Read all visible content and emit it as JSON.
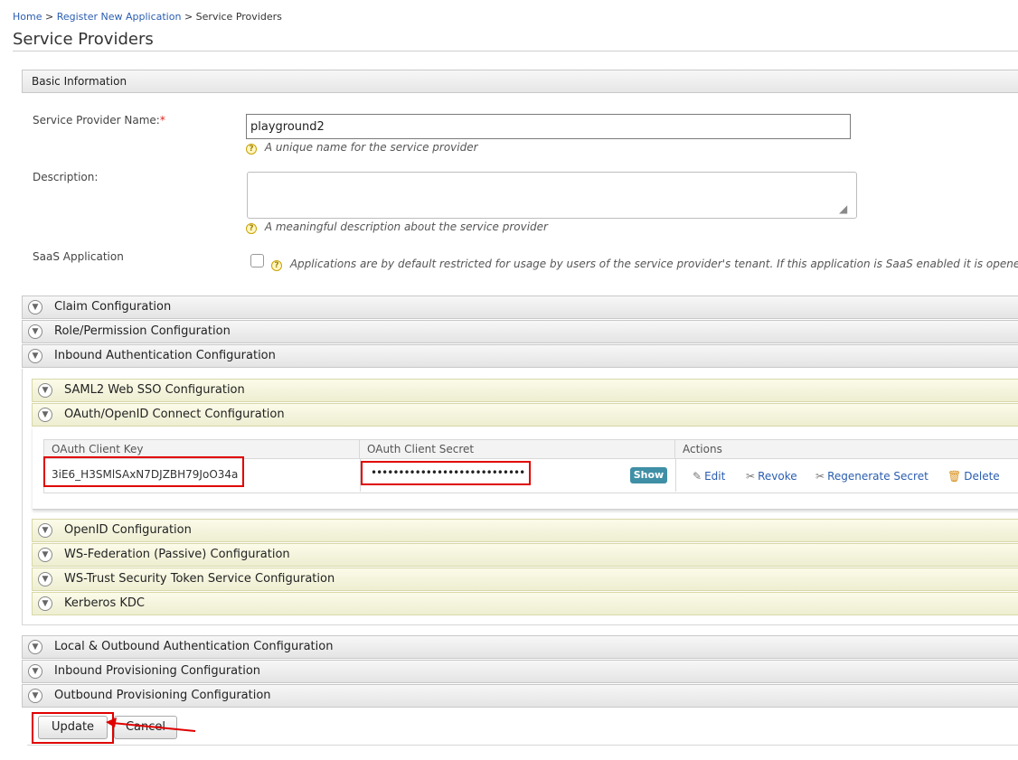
{
  "breadcrumb": {
    "home": "Home",
    "sep1": ">",
    "register": "Register New Application",
    "sep2": ">",
    "current": "Service Providers"
  },
  "page": {
    "title": "Service Providers"
  },
  "basic_info": {
    "header": "Basic Information",
    "name_label": "Service Provider Name:",
    "required_mark": "*",
    "name_value": "playground2",
    "name_hint": "A unique name for the service provider",
    "description_label": "Description:",
    "description_value": "",
    "description_hint": "A meaningful description about the service provider",
    "saas_label": "SaaS Application",
    "saas_checked": false,
    "saas_hint": "Applications are by default restricted for usage by users of the service provider's tenant. If this application is SaaS enabled it is opene"
  },
  "sections": {
    "claim": "Claim Configuration",
    "role": "Role/Permission Configuration",
    "inbound_auth": "Inbound Authentication Configuration",
    "local_outbound": "Local & Outbound Authentication Configuration",
    "inbound_prov": "Inbound Provisioning Configuration",
    "outbound_prov": "Outbound Provisioning Configuration"
  },
  "inbound_subsections": {
    "saml": "SAML2 Web SSO Configuration",
    "oauth": "OAuth/OpenID Connect Configuration",
    "openid": "OpenID Configuration",
    "wsfed": "WS-Federation (Passive) Configuration",
    "wstrust": "WS-Trust Security Token Service Configuration",
    "kerberos": "Kerberos KDC"
  },
  "oauth_table": {
    "headers": {
      "key": "OAuth Client Key",
      "secret": "OAuth Client Secret",
      "actions": "Actions"
    },
    "client_key": "3iE6_H3SMlSAxN7DJZBH79JoO34a",
    "client_secret_masked": "••••••••••••••••••••••••••••",
    "show_label": "Show",
    "actions": {
      "edit": "Edit",
      "revoke": "Revoke",
      "regenerate": "Regenerate Secret",
      "delete": "Delete"
    }
  },
  "buttons": {
    "update": "Update",
    "cancel": "Cancel"
  },
  "colors": {
    "link": "#2a5db0",
    "highlight": "#e00000",
    "show_button": "#3f8fa6"
  },
  "icons": [
    "chevron-down-icon",
    "help-icon",
    "edit-icon",
    "revoke-icon",
    "regenerate-icon",
    "delete-icon",
    "arrow-annotation-icon"
  ]
}
